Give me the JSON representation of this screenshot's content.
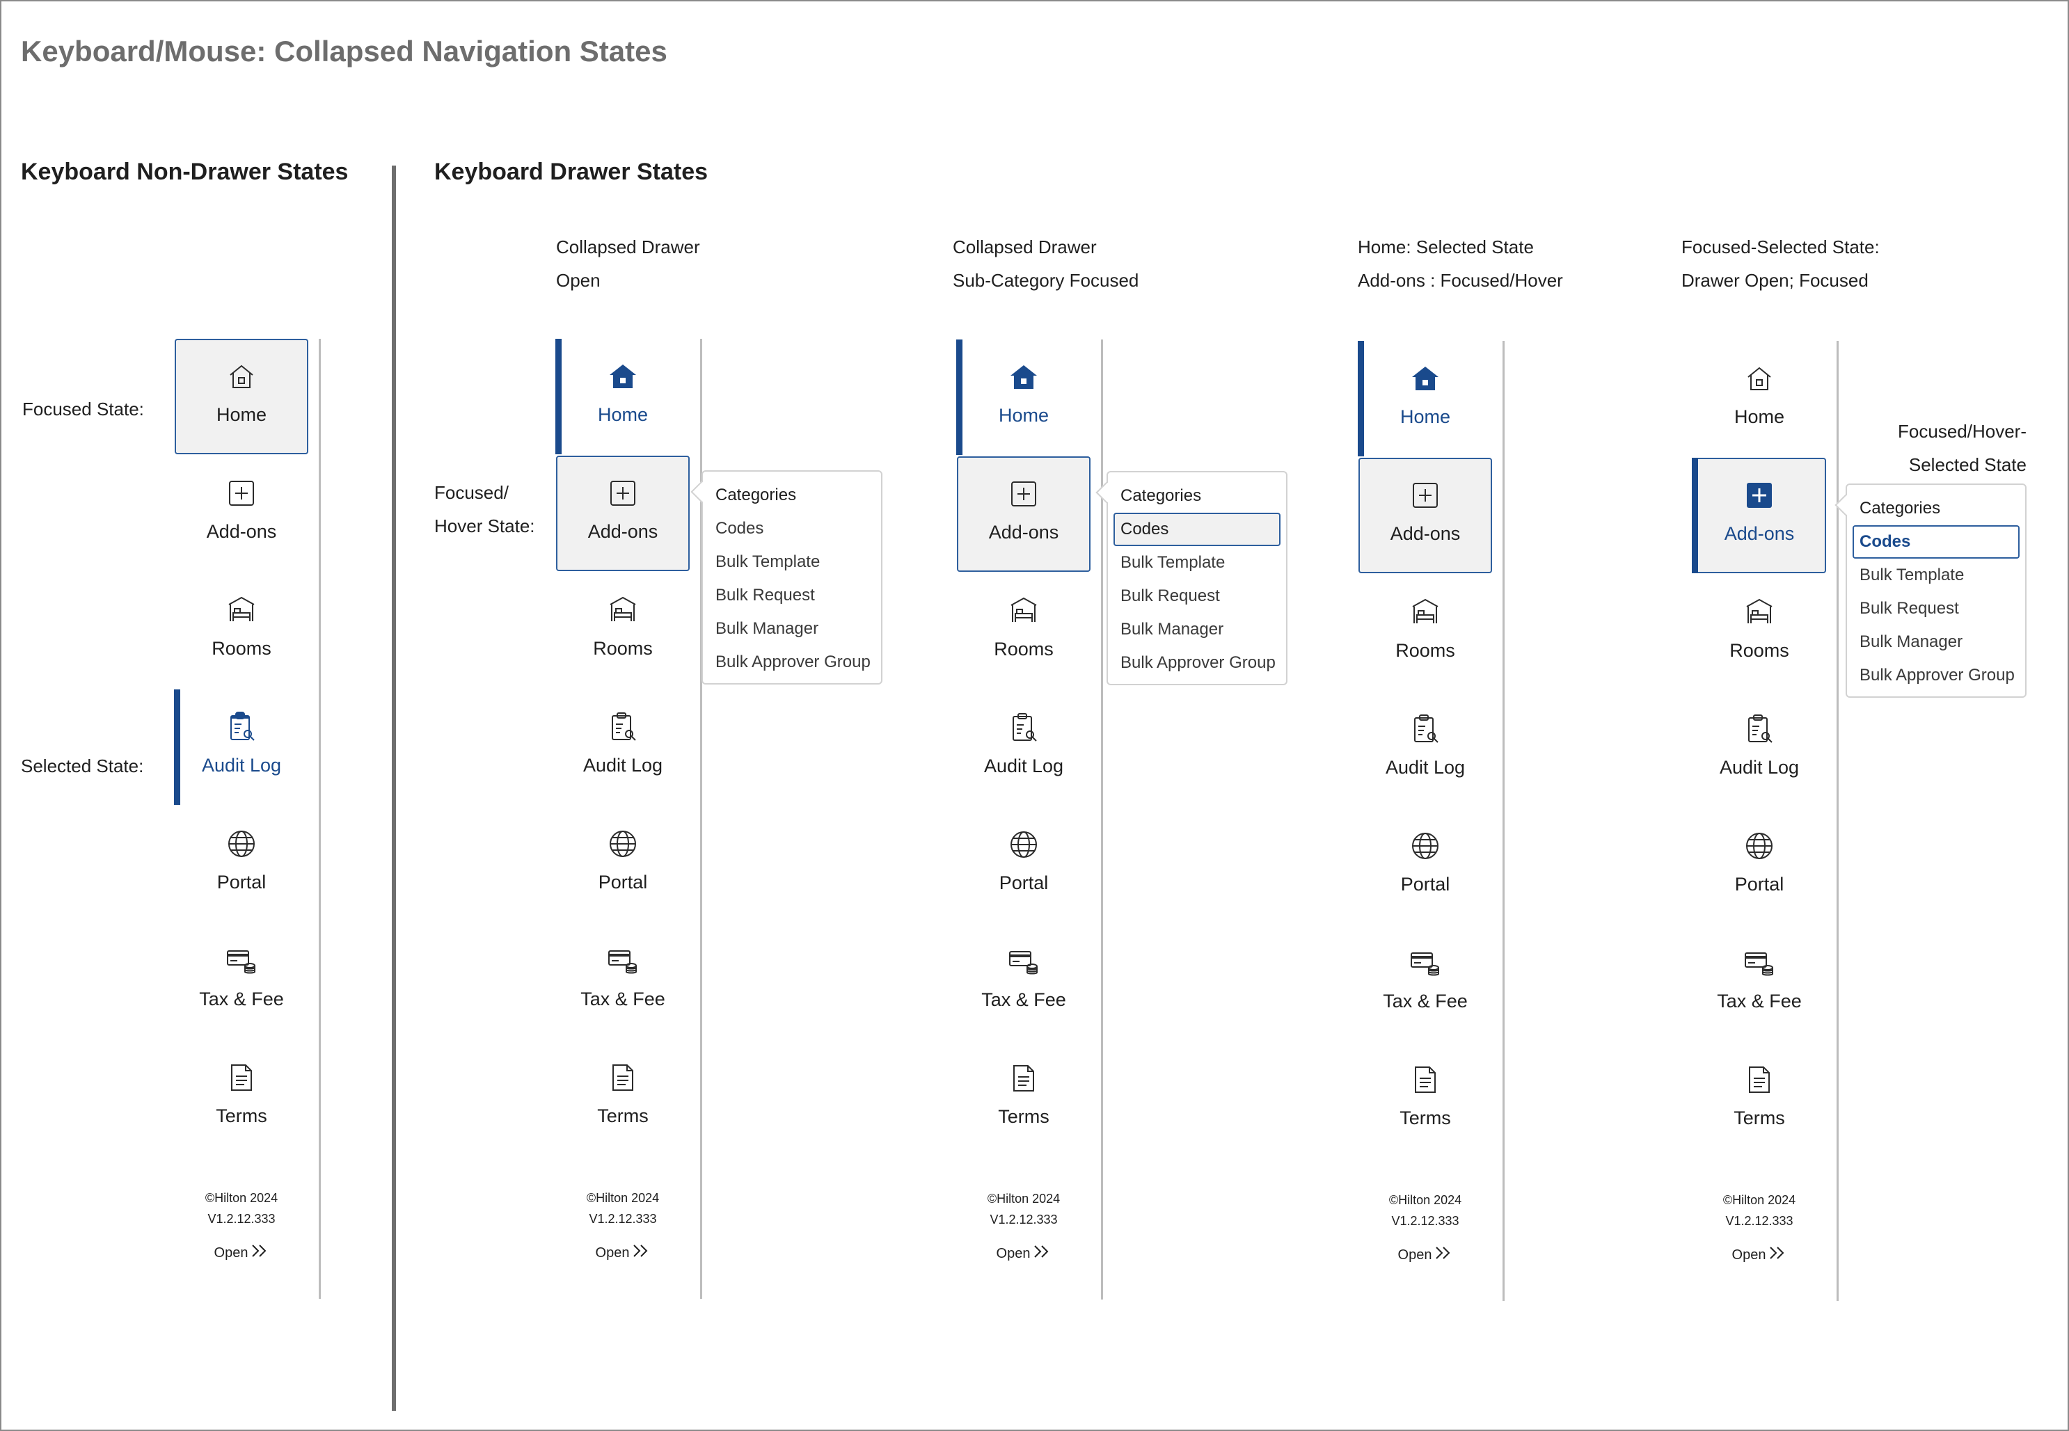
{
  "page": {
    "title": "Keyboard/Mouse: Collapsed Navigation States"
  },
  "sections": {
    "non_drawer": "Keyboard Non-Drawer States",
    "drawer": "Keyboard Drawer States"
  },
  "state_labels": {
    "focused": "Focused State:",
    "selected": "Selected State:",
    "focused_hover_line1": "Focused/",
    "focused_hover_line2": "Hover State:",
    "focused_hover_selected_line1": "Focused/Hover-",
    "focused_hover_selected_line2": "Selected State"
  },
  "columns": [
    {
      "line1": "Collapsed Drawer",
      "line2": "Open"
    },
    {
      "line1": "Collapsed Drawer",
      "line2": "Sub-Category Focused"
    },
    {
      "line1": "Home: Selected State",
      "line2": "Add-ons : Focused/Hover"
    },
    {
      "line1": "Focused-Selected State:",
      "line2": "Drawer Open; Focused"
    }
  ],
  "nav": {
    "items": [
      {
        "label": "Home",
        "icon": "home-icon"
      },
      {
        "label": "Add-ons",
        "icon": "add-box-icon"
      },
      {
        "label": "Rooms",
        "icon": "hotel-bed-icon"
      },
      {
        "label": "Audit Log",
        "icon": "clipboard-search-icon"
      },
      {
        "label": "Portal",
        "icon": "globe-icon"
      },
      {
        "label": "Tax & Fee",
        "icon": "card-coins-icon"
      },
      {
        "label": "Terms",
        "icon": "document-icon"
      }
    ],
    "copyright": "©Hilton 2024",
    "version": "V1.2.12.333",
    "open_label": "Open"
  },
  "flyout": {
    "items": [
      "Categories",
      "Codes",
      "Bulk Template",
      "Bulk Request",
      "Bulk Manager",
      "Bulk Approver Group"
    ]
  },
  "colors": {
    "accent": "#1a4a8c",
    "focus_border": "#2e5f9e",
    "focus_bg": "#f1f1f1",
    "title_gray": "#6d6d6d",
    "divider": "#6e6e6e",
    "rail_rule": "#bdbdbd"
  }
}
